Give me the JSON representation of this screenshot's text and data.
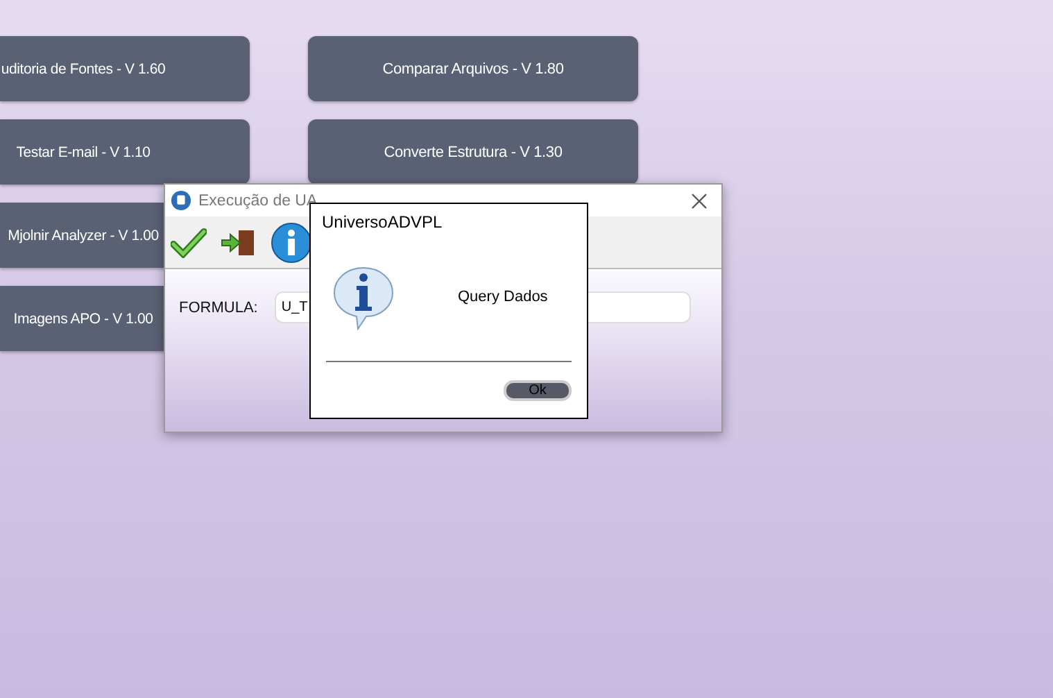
{
  "left_buttons": [
    "uditoria de Fontes - V 1.60",
    "Testar E-mail - V 1.10",
    "Mjolnir Analyzer - V 1.00",
    "Imagens APO - V 1.00"
  ],
  "right_buttons": [
    "Comparar Arquivos - V 1.80",
    "Converte Estrutura - V 1.30"
  ],
  "window": {
    "title": "Execução de UA",
    "fields": [
      {
        "label": "FORMULA:",
        "value": "U_T"
      }
    ]
  },
  "dialog": {
    "title": "UniversoADVPL",
    "message": "Query Dados",
    "buttons": [
      "Ok"
    ]
  }
}
